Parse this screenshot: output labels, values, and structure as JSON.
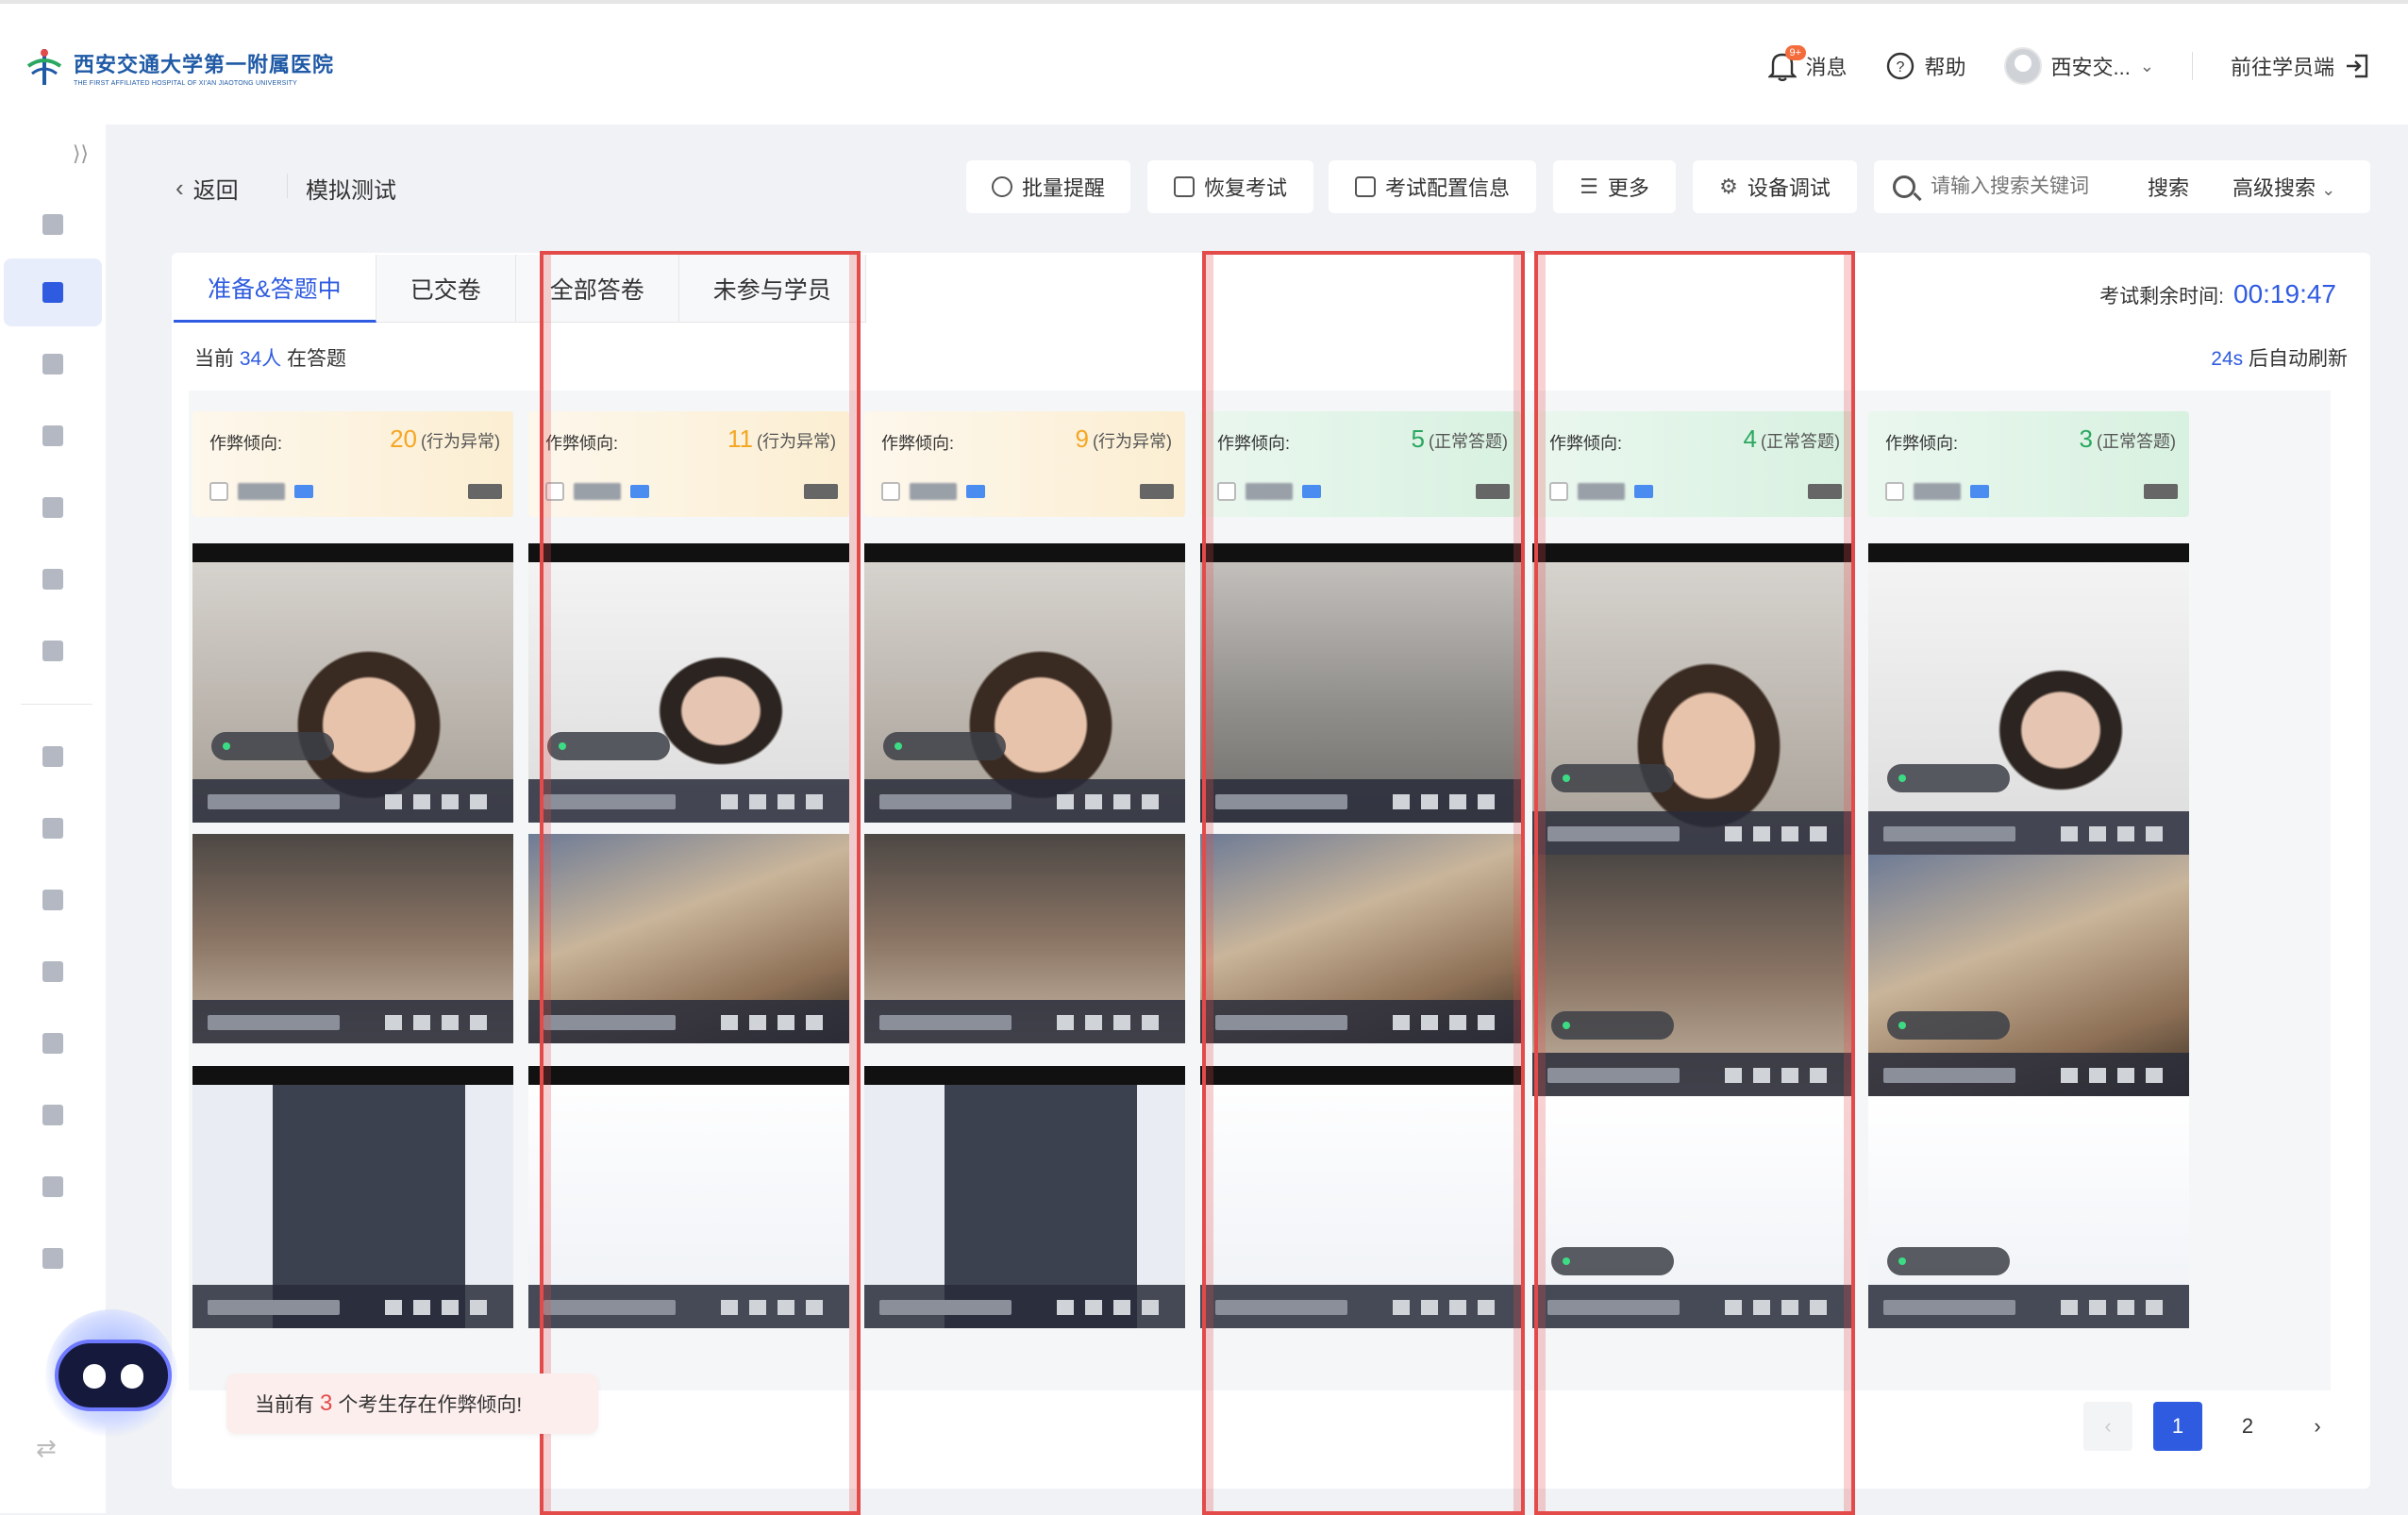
{
  "header": {
    "logo_cn": "西安交通大学第一附属医院",
    "logo_en": "THE FIRST AFFILIATED HOSPITAL OF XI'AN JIAOTONG UNIVERSITY",
    "messages_label": "消息",
    "messages_badge": "9+",
    "help_label": "帮助",
    "user_name": "西安交...",
    "goto_student": "前往学员端"
  },
  "toolbar": {
    "back_label": "返回",
    "crumb": "模拟测试",
    "buttons": [
      "批量提醒",
      "恢复考试",
      "考试配置信息",
      "更多",
      "设备调试"
    ],
    "search_placeholder": "请输入搜索关键词",
    "search_button": "搜索",
    "advanced_search": "高级搜索"
  },
  "tabs": [
    "准备&答题中",
    "已交卷",
    "全部答卷",
    "未参与学员"
  ],
  "timer": {
    "label": "考试剩余时间:",
    "value": "00:19:47"
  },
  "status": {
    "prefix": "当前",
    "count": "34人",
    "suffix": "在答题"
  },
  "refresh": {
    "seconds": "24s",
    "suffix": "后自动刷新"
  },
  "cards": [
    {
      "label": "作弊倾向:",
      "score": "20",
      "tag": "(行为异常)",
      "kind": "warn",
      "flagged": false
    },
    {
      "label": "作弊倾向:",
      "score": "11",
      "tag": "(行为异常)",
      "kind": "warn",
      "flagged": true
    },
    {
      "label": "作弊倾向:",
      "score": "9",
      "tag": "(行为异常)",
      "kind": "warn",
      "flagged": false
    },
    {
      "label": "作弊倾向:",
      "score": "5",
      "tag": "(正常答题)",
      "kind": "ok",
      "flagged": true
    },
    {
      "label": "作弊倾向:",
      "score": "4",
      "tag": "(正常答题)",
      "kind": "ok",
      "flagged": true
    },
    {
      "label": "作弊倾向:",
      "score": "3",
      "tag": "(正常答题)",
      "kind": "ok",
      "flagged": false
    }
  ],
  "toast": {
    "prefix": "当前有",
    "count": "3",
    "suffix": "个考生存在作弊倾向!"
  },
  "pagination": {
    "prev": "‹",
    "pages": [
      "1",
      "2"
    ],
    "next": "›",
    "current": "1"
  },
  "colors": {
    "primary": "#2f5be0",
    "warn": "#f5a623",
    "ok": "#2aa760",
    "alert": "#e34b4b"
  }
}
